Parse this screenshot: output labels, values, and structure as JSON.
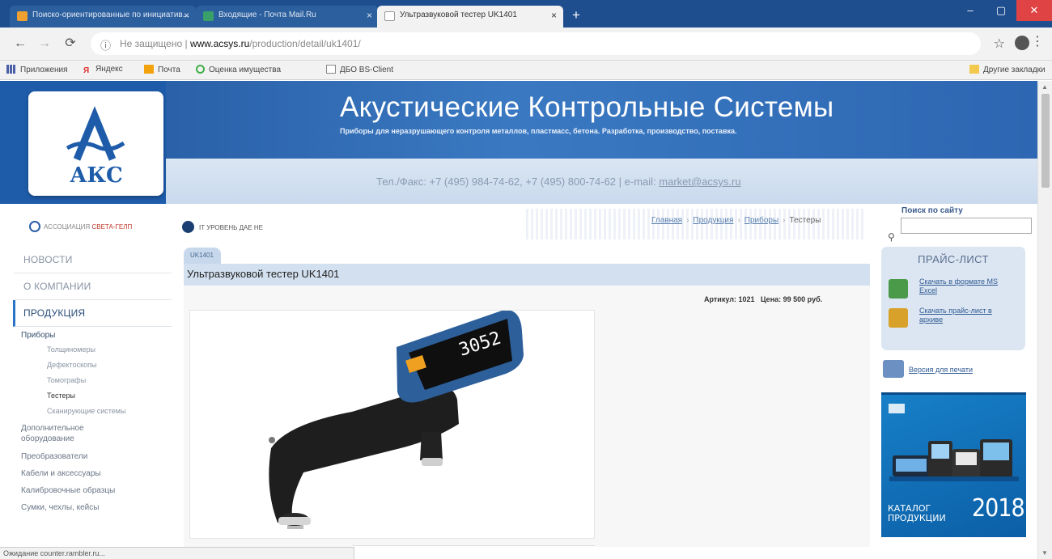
{
  "browser": {
    "tabs": [
      {
        "label": "Поиско-ориентированные по инициатив...",
        "active": false,
        "favicon_color": "#f0a030"
      },
      {
        "label": "Входящие - Почта Mail.Ru",
        "active": false,
        "favicon_color": "#3aa06a"
      },
      {
        "label": "Ультразвуковой тестер UK1401",
        "active": true,
        "favicon_color": "#ffffff"
      }
    ],
    "new_tab_label": "+",
    "window_buttons": {
      "minimize": "–",
      "maximize": "▢",
      "close": "✕"
    },
    "address": {
      "security": "Не защищено",
      "domain": "www.acsys.ru",
      "path": "/production/detail/uk1401/"
    },
    "bookmarks": [
      {
        "label": "Приложения",
        "icon_color": "#4a5fa8"
      },
      {
        "label": "Яндекс",
        "icon_color": "#e03030"
      },
      {
        "label": "Почта",
        "icon_color": "#f2a20d"
      },
      {
        "label": "Оценка имущества",
        "icon_color": "#3fae49"
      },
      {
        "label": "ДБО BS-Client",
        "icon_color": "#ffffff"
      }
    ],
    "other_bookmarks": "Другие закладки",
    "status": "Ожидание counter.rambler.ru..."
  },
  "header": {
    "logo_text": "АКС",
    "title": "Акустические Контрольные Системы",
    "tagline": "Приборы для неразрушающего контроля металлов, пластмасс, бетона. Разработка, производство, поставка.",
    "contacts_prefix": "Тел./Факс: +7 (495) 984-74-62, +7 (495) 800-74-62 | e-mail: ",
    "email": "market@acsys.ru"
  },
  "strip": {
    "association": "АССОЦИАЦИЯ",
    "association_highlight": "СВЕТА-ГЕЛП",
    "level": "IT УРОВЕНЬ ДАЕ НЕ"
  },
  "breadcrumbs": [
    "Главная",
    "Продукция",
    "Приборы",
    "Тестеры"
  ],
  "search": {
    "label": "Поиск по сайту",
    "value": ""
  },
  "nav": {
    "main": [
      {
        "label": "НОВОСТИ",
        "active": false
      },
      {
        "label": "О КОМПАНИИ",
        "active": false
      },
      {
        "label": "ПРОДУКЦИЯ",
        "active": true
      }
    ],
    "sub": [
      {
        "label": "Приборы",
        "level": 1,
        "state": "sel"
      },
      {
        "label": "Толщиномеры",
        "level": 2
      },
      {
        "label": "Дефектоскопы",
        "level": 2
      },
      {
        "label": "Томографы",
        "level": 2
      },
      {
        "label": "Тестеры",
        "level": 2,
        "state": "cur"
      },
      {
        "label": "Сканирующие системы",
        "level": 2
      },
      {
        "label": "Дополнительное оборудование",
        "level": 1
      },
      {
        "label": "Преобразователи",
        "level": 1
      },
      {
        "label": "Кабели и аксессуары",
        "level": 1
      },
      {
        "label": "Калибровочные образцы",
        "level": 1
      },
      {
        "label": "Сумки, чехлы, кейсы",
        "level": 1
      }
    ]
  },
  "product": {
    "tag": "UK1401",
    "title": "Ультразвуковой тестер UK1401",
    "article_label": "Артикул:",
    "article": "1021",
    "price_label": "Цена:",
    "price": "99 500 руб.",
    "device_reading": "3052"
  },
  "pricelist": {
    "heading": "ПРАЙС-ЛИСТ",
    "excel_link": "Скачать в формате MS Excel",
    "zip_link": "Скачать прайс-лист в архиве",
    "print_link": "Версия для печати"
  },
  "catalog": {
    "label_line1": "КАТАЛОГ",
    "label_line2": "ПРОДУКЦИИ",
    "year": "2018"
  }
}
